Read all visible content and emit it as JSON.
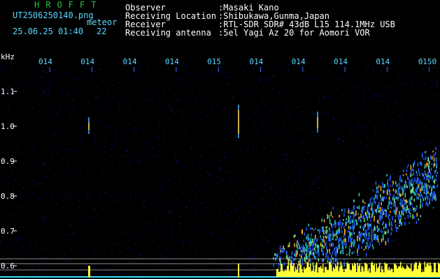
{
  "header": {
    "title": "HROFFT",
    "filename": "UT2506250140.png",
    "mode": "meteor",
    "date_time": "25.06.25 01:40",
    "count": "22",
    "fields": [
      {
        "label": "Observer",
        "value": ":Masaki Kano"
      },
      {
        "label": "Receiving Location",
        "value": ":Shibukawa,Gunma,Japan"
      },
      {
        "label": "Receiver",
        "value": ":RTL-SDR SDR# 43dB L15 114.1MHz USB"
      },
      {
        "label": "Receiving antenna",
        "value": ":5el Yagi Az 20 for Aomori VOR"
      }
    ]
  },
  "axis": {
    "unit": "kHz",
    "y_ticks": [
      "1.1",
      "1.0",
      "0.9",
      "0.8",
      "0.7",
      "0.6"
    ],
    "x_ticks": [
      "014",
      "014",
      "014",
      "014",
      "015",
      "014",
      "014",
      "014",
      "014",
      "0150"
    ]
  },
  "colors": {
    "background": "#000000",
    "text": "#ffffff",
    "title_green": "#22c83a",
    "tick_cyan": "#5ad7ff",
    "signal_yellow": "#ffff33",
    "noise_blue": "#0a1a8c"
  }
}
